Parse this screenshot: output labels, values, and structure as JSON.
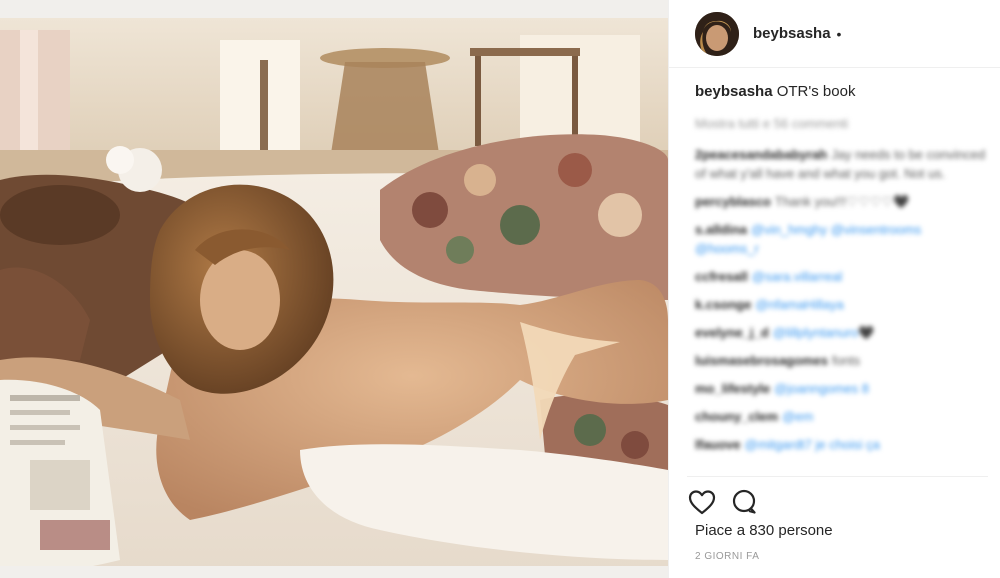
{
  "post": {
    "username": "beybsasha",
    "follow_dot": "•",
    "caption": {
      "username": "beybsasha",
      "text": "OTR's book"
    },
    "view_all_comments": "Mostra tutti e 56 commenti",
    "comments": [
      {
        "user": "2peacesandababyrah",
        "text": "Jay needs to be convinced of what y'all have and what you got. Not us."
      },
      {
        "user": "percyblasco",
        "text": "Thank you!!!♡♡♡♡🖤"
      },
      {
        "user": "s.alldina",
        "text": "@vin_hmghy @vinsentrooms @hooms_r"
      },
      {
        "user": "ccfresall",
        "text": "@sara.villarreal"
      },
      {
        "user": "k.csonge",
        "text": "@nfamaHillaya"
      },
      {
        "user": "evelyne_j_d",
        "text": "@lillplyntanuro🖤"
      },
      {
        "user": "luismasebrosagomes",
        "text": "fonts"
      },
      {
        "user": "mo_lifestyle",
        "text": "@joanngomes 8"
      },
      {
        "user": "chouny_clem",
        "text": "@em"
      },
      {
        "user": "lfauove",
        "text": "@mitgardt7 je choisi ça"
      }
    ],
    "actions": {
      "like_icon": "heart-icon",
      "comment_icon": "comment-bubble-icon"
    },
    "likes_text": "Piace a 830 persone",
    "time_text": "2 GIORNI FA"
  }
}
